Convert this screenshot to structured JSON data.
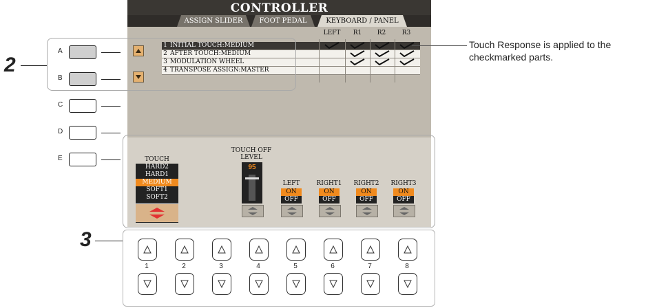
{
  "screen": {
    "title": "CONTROLLER",
    "tabs": [
      "ASSIGN SLIDER",
      "FOOT PEDAL",
      "KEYBOARD / PANEL"
    ],
    "active_tab": "KEYBOARD / PANEL",
    "columns": [
      "LEFT",
      "R1",
      "R2",
      "R3"
    ],
    "rows": [
      {
        "num": "1",
        "label": "INITIAL TOUCH:MEDIUM",
        "checks": [
          true,
          true,
          true,
          true
        ]
      },
      {
        "num": "2",
        "label": "AFTER TOUCH:MEDIUM",
        "checks": [
          false,
          true,
          true,
          true
        ]
      },
      {
        "num": "3",
        "label": "MODULATION WHEEL",
        "checks": [
          false,
          true,
          true,
          true
        ]
      },
      {
        "num": "4",
        "label": "TRANSPOSE ASSIGN:MASTER",
        "checks": [
          false,
          false,
          false,
          false
        ]
      }
    ],
    "touch": {
      "label": "TOUCH",
      "options": [
        "HARD2",
        "HARD1",
        "MEDIUM",
        "SOFT1",
        "SOFT2"
      ],
      "selected": "MEDIUM"
    },
    "touch_off": {
      "label_line1": "TOUCH OFF",
      "label_line2": "LEVEL",
      "value": "95"
    },
    "parts": [
      {
        "label": "LEFT",
        "on": "ON",
        "off": "OFF"
      },
      {
        "label": "RIGHT1",
        "on": "ON",
        "off": "OFF"
      },
      {
        "label": "RIGHT2",
        "on": "ON",
        "off": "OFF"
      },
      {
        "label": "RIGHT3",
        "on": "ON",
        "off": "OFF"
      }
    ]
  },
  "side_buttons": [
    "A",
    "B",
    "C",
    "D",
    "E"
  ],
  "callouts": {
    "step2": "2",
    "step3": "3"
  },
  "annotation": {
    "line1": "Touch Response is applied to the",
    "line2": "checkmarked parts."
  },
  "panel_buttons": [
    "1",
    "2",
    "3",
    "4",
    "5",
    "6",
    "7",
    "8"
  ],
  "colors": {
    "accent": "#f08a1e",
    "screen_bg": "#bfb9ae",
    "title_bar": "#3a3733"
  }
}
